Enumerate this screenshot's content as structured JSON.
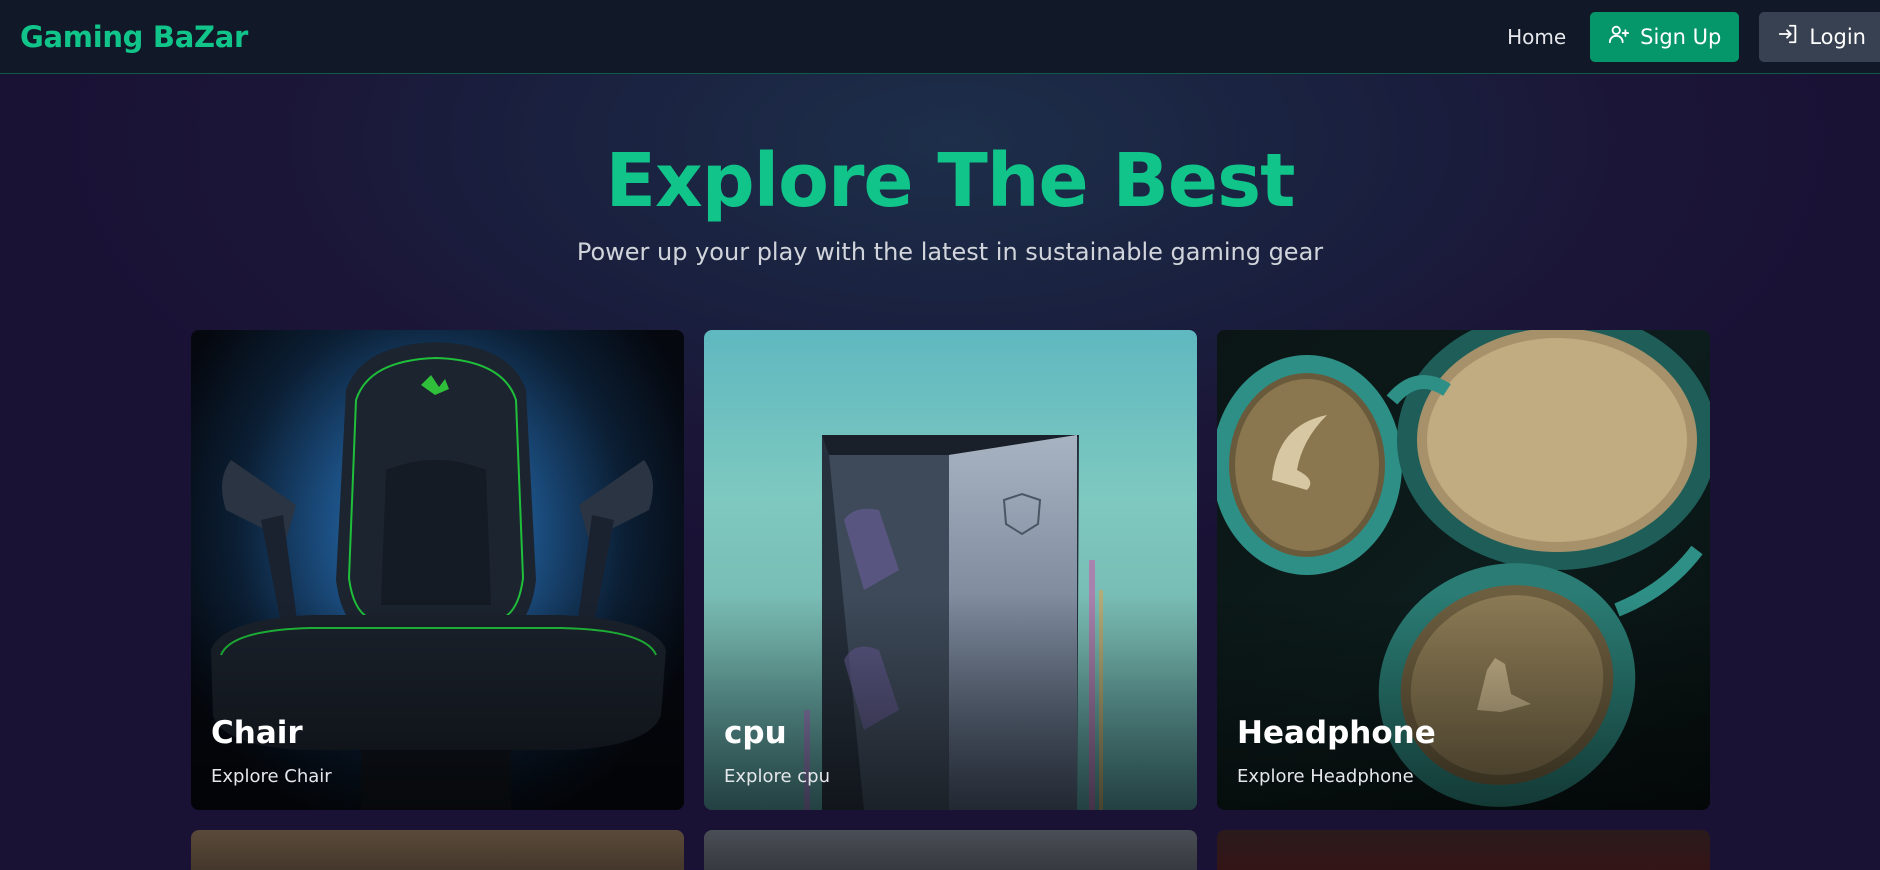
{
  "brand": "Gaming BaZar",
  "nav": {
    "home": "Home",
    "signup": "Sign Up",
    "login": "Login",
    "signup_icon": "user-plus-icon",
    "login_icon": "login-icon"
  },
  "hero": {
    "title": "Explore The Best",
    "subtitle": "Power up your play with the latest in sustainable gaming gear"
  },
  "cards": [
    {
      "title": "Chair",
      "subtitle": "Explore Chair"
    },
    {
      "title": "cpu",
      "subtitle": "Explore cpu"
    },
    {
      "title": "Headphone",
      "subtitle": "Explore Headphone"
    }
  ],
  "colors": {
    "accent": "#10c48a",
    "signup_bg": "#059669",
    "login_bg": "#374151",
    "navbar_bg": "#111827"
  }
}
